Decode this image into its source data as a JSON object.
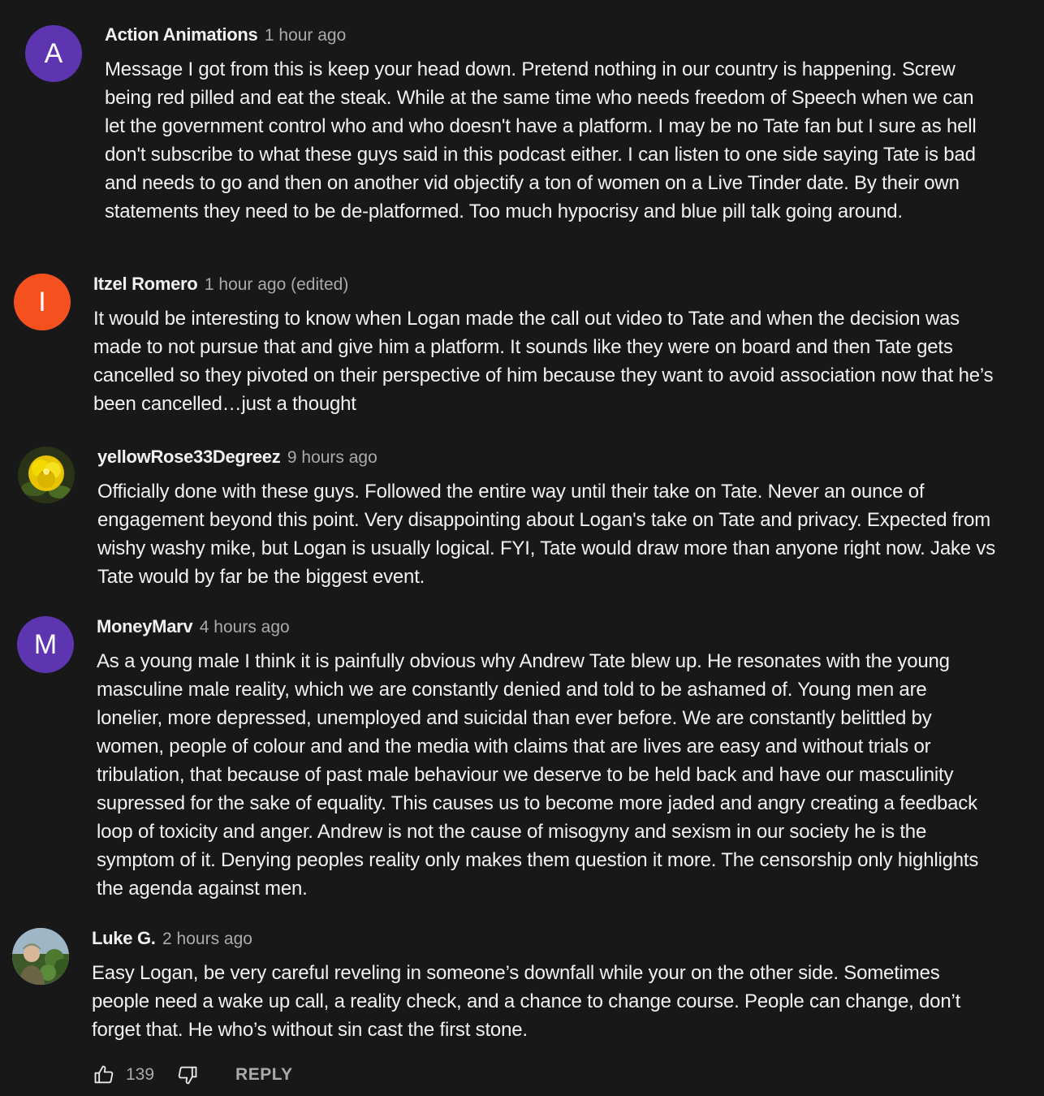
{
  "comments": [
    {
      "author": "Action Animations",
      "time": "1 hour ago",
      "text": "Message I got from this is keep your head down. Pretend nothing in our country is happening. Screw being red pilled and eat the steak. While at the same time who needs freedom of Speech when we can let the government control who and who doesn't have a platform. I may be no Tate fan but I sure as hell don't subscribe to what these guys said in this podcast either. I can listen to one side saying Tate is bad and needs to go and then on another vid objectify a ton of women on a Live Tinder date. By their own statements they need to be de-platformed. Too much hypocrisy and blue pill talk going around.",
      "avatar_letter": "A",
      "avatar_color": "#5e35b1"
    },
    {
      "author": "Itzel Romero",
      "time": "1 hour ago (edited)",
      "text": "It would be interesting to know when Logan made the call out video to Tate and when the decision was made to not pursue that and give him a platform. It sounds like they were on board and then Tate gets cancelled so they pivoted on their perspective of him because they want to avoid association now that he’s been cancelled…just a thought",
      "avatar_letter": "I",
      "avatar_color": "#f4511e"
    },
    {
      "author": "yellowRose33Degreez",
      "time": "9 hours ago",
      "text": "Officially done with these guys. Followed the entire way until their take on Tate. Never an ounce of engagement beyond this point. Very disappointing about Logan's take on Tate and privacy. Expected from wishy washy mike, but Logan is usually logical. FYI, Tate would draw more than anyone right now. Jake vs Tate would by far be the biggest event.",
      "avatar_icon": "yellow-rose-avatar"
    },
    {
      "author": "MoneyMarv",
      "time": "4 hours ago",
      "text": "As a young male I think it is painfully obvious why Andrew Tate blew up. He resonates with the young masculine male reality, which we are constantly denied and told to be ashamed of. Young men are lonelier, more depressed, unemployed and suicidal than ever before. We are constantly belittled by women, people of colour and and the media with claims that are lives are easy and without trials or tribulation, that because of past male behaviour we deserve to be held back and have our masculinity supressed for the sake of equality. This causes us to become more jaded and angry creating a feedback loop of toxicity and anger. Andrew is not the cause of misogyny and sexism in our society he is the symptom of it. Denying peoples reality only makes them question it more. The censorship only highlights the agenda against men.",
      "avatar_letter": "M",
      "avatar_color": "#5e35b1"
    },
    {
      "author": "Luke G.",
      "time": "2 hours ago",
      "text": "Easy Logan, be very careful reveling in someone’s downfall while your on the other side. Sometimes people need a wake up call, a reality check, and a chance to change course. People can change, don’t forget that. He who’s without sin cast the first stone.",
      "avatar_icon": "photo-avatar"
    }
  ],
  "actions": {
    "like_count": "139",
    "reply_label": "REPLY"
  },
  "colors": {
    "background": "#181818",
    "text": "#f1f1f1",
    "secondary": "#aaaaaa"
  }
}
